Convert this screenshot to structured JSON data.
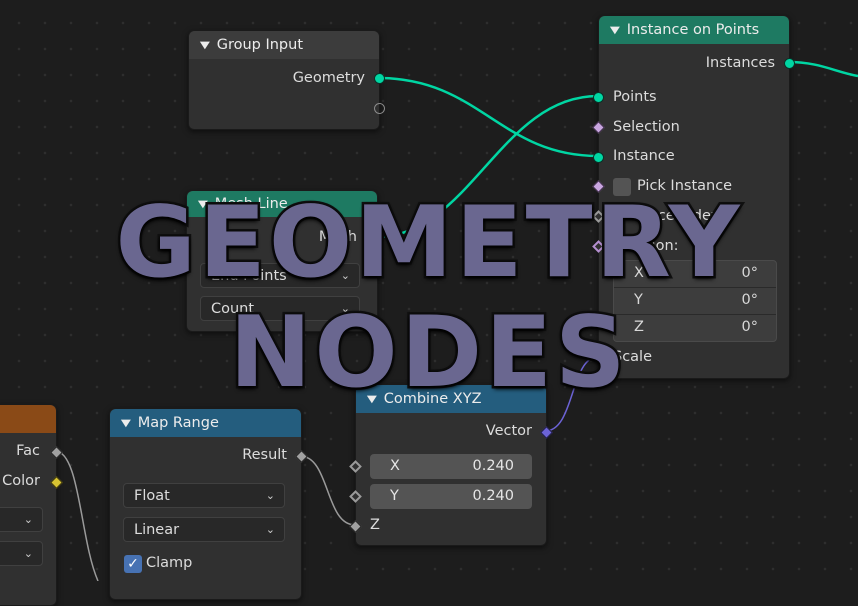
{
  "colors": {
    "geometry": "#00d6a3",
    "field": "#c9a6e0",
    "vector": "#6c63d6",
    "float": "#a1a1a1",
    "color": "#d8c432",
    "header_geometry": "#1e7a62",
    "header_converter": "#245d7e",
    "header_input": "#3c3c3c",
    "header_texture": "#8a4a17"
  },
  "group_input": {
    "title": "Group Input",
    "outputs": [
      "Geometry"
    ]
  },
  "instance_on_points": {
    "title": "Instance on Points",
    "output": "Instances",
    "inputs": [
      "Points",
      "Selection",
      "Instance",
      "Pick Instance",
      "Instance Index",
      "Rotation:",
      "Scale"
    ],
    "rotation": [
      {
        "label": "X",
        "value": "0°"
      },
      {
        "label": "Y",
        "value": "0°"
      },
      {
        "label": "Z",
        "value": "0°"
      }
    ]
  },
  "mesh_line": {
    "title": "Mesh Line",
    "output": "Mesh",
    "mode_1": "End Points",
    "mode_2": "Count"
  },
  "combine_xyz": {
    "title": "Combine XYZ",
    "output": "Vector",
    "x": {
      "label": "X",
      "value": "0.240"
    },
    "y": {
      "label": "Y",
      "value": "0.240"
    },
    "z": "Z"
  },
  "map_range": {
    "title": "Map Range",
    "output": "Result",
    "data_type": "Float",
    "interpolation": "Linear",
    "clamp": "Clamp"
  },
  "partial_node": {
    "outputs": [
      "Fac",
      "Color"
    ]
  },
  "overlay": {
    "line1": "GEOMETRY",
    "line2": "NODES"
  },
  "icons": [
    "chevron-down-icon",
    "dropdown-arrow-icon",
    "checkmark-icon"
  ]
}
